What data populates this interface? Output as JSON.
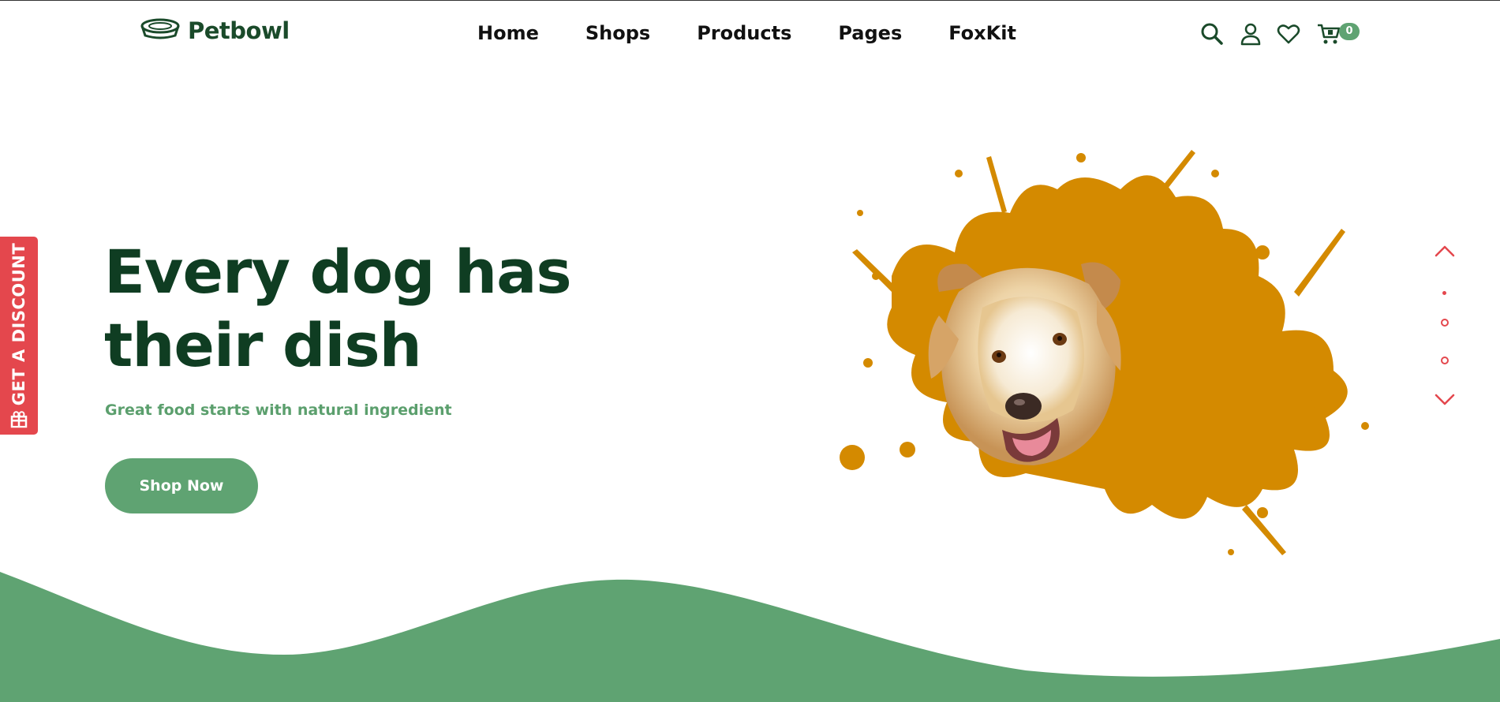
{
  "header": {
    "brand": "Petbowl",
    "nav": [
      {
        "label": "Home"
      },
      {
        "label": "Shops"
      },
      {
        "label": "Products"
      },
      {
        "label": "Pages"
      },
      {
        "label": "FoxKit"
      }
    ],
    "icons": [
      "search-icon",
      "user-icon",
      "heart-icon",
      "cart-icon"
    ],
    "cart_count": "0"
  },
  "hero": {
    "title_line1": "Every dog has",
    "title_line2": "their dish",
    "subtitle": "Great food starts with natural ingredient",
    "button_label": "Shop Now",
    "slides_total": 3,
    "active_slide": 1
  },
  "discount_tab": {
    "label": "GET A DISCOUNT",
    "icon": "gift-icon"
  },
  "colors": {
    "brand_dark": "#0f3d22",
    "brand_green": "#5fa372",
    "accent_red": "#e4474d",
    "splash_orange": "#d48a00"
  }
}
